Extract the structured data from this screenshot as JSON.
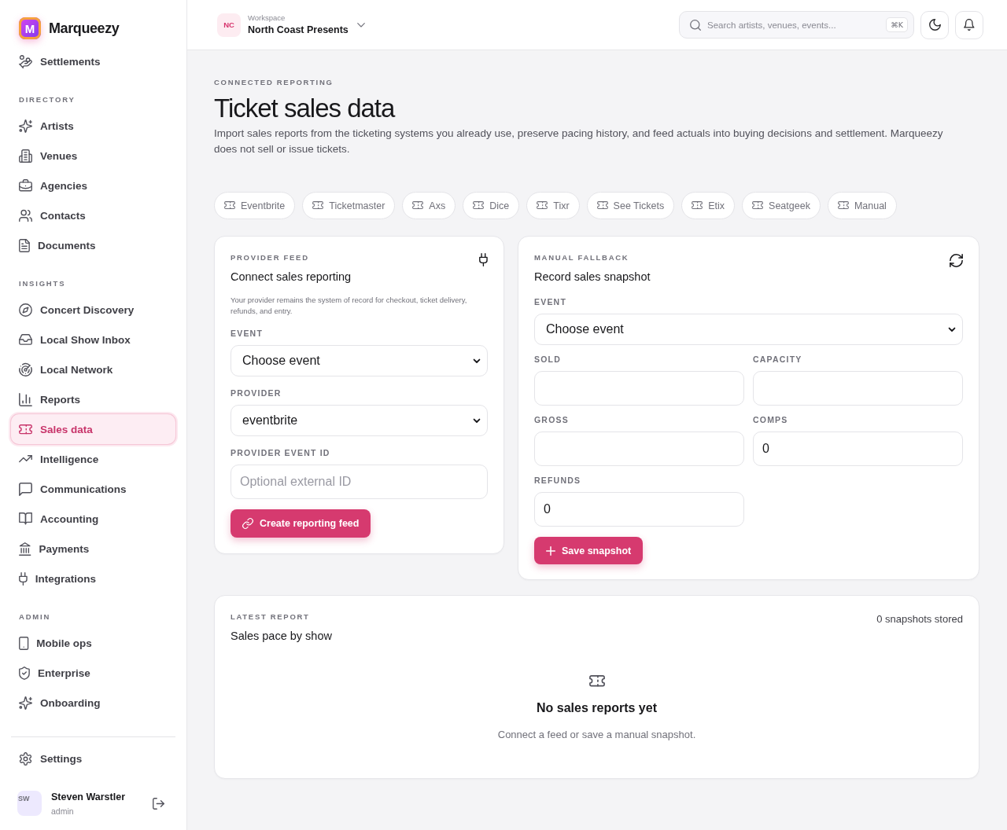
{
  "sidebar": {
    "brand": {
      "mark": "M",
      "name": "Marqueezy"
    },
    "groups": [
      {
        "items": [
          {
            "label": "Settlements",
            "selected": false
          }
        ]
      },
      {
        "heading": "DIRECTORY",
        "items": [
          {
            "label": "Artists",
            "selected": false
          },
          {
            "label": "Venues",
            "selected": false
          },
          {
            "label": "Agencies",
            "selected": false
          },
          {
            "label": "Contacts",
            "selected": false
          },
          {
            "label": "Documents",
            "selected": false
          }
        ]
      },
      {
        "heading": "INSIGHTS",
        "items": [
          {
            "label": "Concert Discovery",
            "selected": false
          },
          {
            "label": "Local Show Inbox",
            "selected": false
          },
          {
            "label": "Local Network",
            "selected": false
          },
          {
            "label": "Reports",
            "selected": false
          },
          {
            "label": "Sales data",
            "selected": true
          },
          {
            "label": "Intelligence",
            "selected": false
          },
          {
            "label": "Communications",
            "selected": false
          },
          {
            "label": "Accounting",
            "selected": false
          },
          {
            "label": "Payments",
            "selected": false
          },
          {
            "label": "Integrations",
            "selected": false
          }
        ]
      },
      {
        "heading": "ADMIN",
        "items": [
          {
            "label": "Mobile ops",
            "selected": false
          },
          {
            "label": "Enterprise",
            "selected": false
          },
          {
            "label": "Onboarding",
            "selected": false
          }
        ]
      }
    ],
    "footer_items": [
      {
        "label": "Settings",
        "selected": false
      }
    ],
    "user": {
      "initials": "SW",
      "name": "Steven Warstler",
      "role": "admin"
    }
  },
  "topbar": {
    "workspace": {
      "initials": "NC",
      "caption": "Workspace",
      "name": "North Coast Presents"
    },
    "search": {
      "placeholder": "Search artists, venues, events...",
      "shortcut": "⌘K"
    }
  },
  "header": {
    "eyebrow": "CONNECTED REPORTING",
    "title": "Ticket sales data",
    "description": "Import sales reports from the ticketing systems you already use, preserve pacing history, and feed actuals into buying decisions and settlement. Marqueezy does not sell or issue tickets."
  },
  "providers": [
    "Eventbrite",
    "Ticketmaster",
    "Axs",
    "Dice",
    "Tixr",
    "See Tickets",
    "Etix",
    "Seatgeek",
    "Manual"
  ],
  "provider_feed": {
    "eyebrow": "PROVIDER FEED",
    "title": "Connect sales reporting",
    "note": "Your provider remains the system of record for checkout, ticket delivery, refunds, and entry.",
    "fields": [
      {
        "kind": "select",
        "label": "EVENT",
        "value": "Choose event"
      },
      {
        "kind": "select",
        "label": "PROVIDER",
        "value": "eventbrite"
      },
      {
        "kind": "input",
        "label": "PROVIDER EVENT ID",
        "placeholder": "Optional external ID"
      }
    ],
    "button": "Create reporting feed"
  },
  "manual_fallback": {
    "eyebrow": "MANUAL FALLBACK",
    "title": "Record sales snapshot",
    "fields": [
      {
        "kind": "select",
        "label": "EVENT",
        "value": "Choose event"
      },
      {
        "kind": "input",
        "label": "SOLD"
      },
      {
        "kind": "input",
        "label": "CAPACITY"
      },
      {
        "kind": "input",
        "label": "GROSS"
      },
      {
        "kind": "input",
        "label": "COMPS",
        "value": "0"
      },
      {
        "kind": "input",
        "label": "REFUNDS",
        "value": "0"
      }
    ],
    "button": "Save snapshot"
  },
  "latest_report": {
    "eyebrow": "LATEST REPORT",
    "title": "Sales pace by show",
    "count": "0 snapshots stored",
    "empty_title": "No sales reports yet",
    "empty_text": "Connect a feed or save a manual snapshot."
  }
}
